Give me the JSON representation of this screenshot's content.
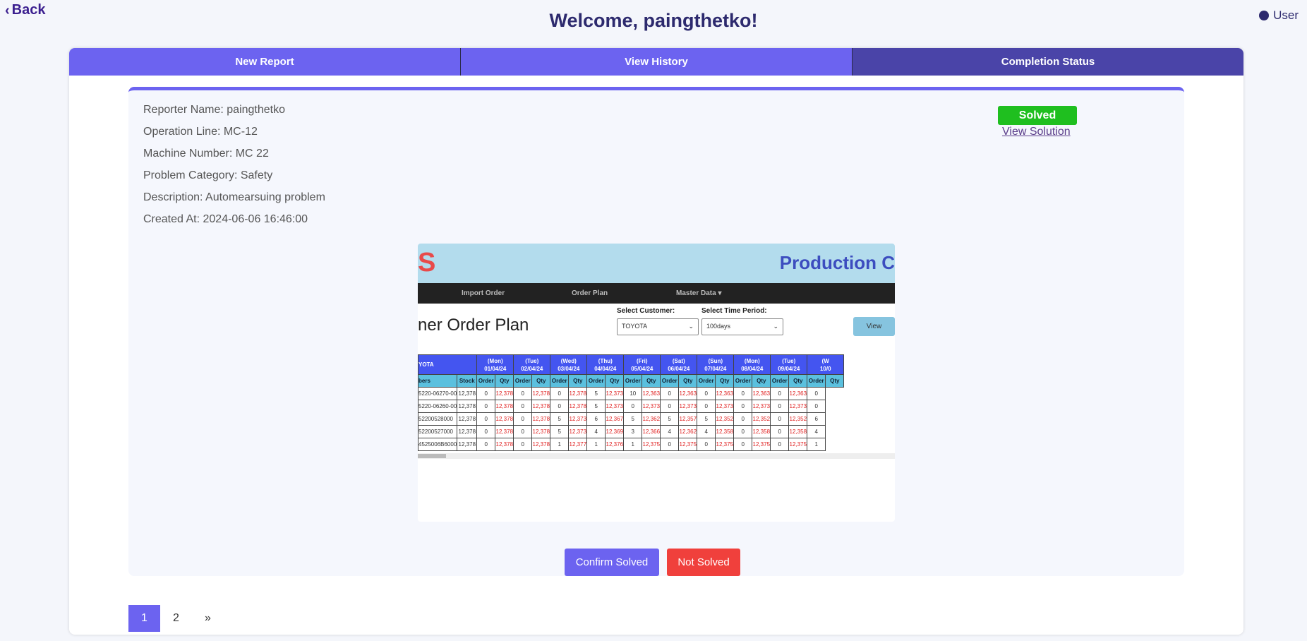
{
  "back_label": "Back",
  "user_label": "User",
  "title": "Welcome, paingthetko!",
  "tabs": [
    {
      "label": "New Report"
    },
    {
      "label": "View History"
    },
    {
      "label": "Completion Status"
    }
  ],
  "report": {
    "reporter": "Reporter Name: paingthetko",
    "line": "Operation Line: MC-12",
    "machine": "Machine Number: MC 22",
    "category": "Problem Category: Safety",
    "description": "Description: Automearsuing problem",
    "created": "Created At: 2024-06-06 16:46:00",
    "status": "Solved",
    "view_solution": "View Solution"
  },
  "shot": {
    "logo_letter": "S",
    "app_title": "Production C",
    "nav": [
      "Import Order",
      "Order Plan",
      "Master Data ▾"
    ],
    "plan_title": "ner Order Plan",
    "customer_label": "Select Customer:",
    "customer_value": "TOYOTA",
    "period_label": "Select Time Period:",
    "period_value": "100days",
    "view_btn": "View",
    "table": {
      "customer": "YOTA",
      "numbers_header": "bers",
      "stock_header": "Stock",
      "days": [
        {
          "d": "(Mon)",
          "date": "01/04/24"
        },
        {
          "d": "(Tue)",
          "date": "02/04/24"
        },
        {
          "d": "(Wed)",
          "date": "03/04/24"
        },
        {
          "d": "(Thu)",
          "date": "04/04/24"
        },
        {
          "d": "(Fri)",
          "date": "05/04/24"
        },
        {
          "d": "(Sat)",
          "date": "06/04/24"
        },
        {
          "d": "(Sun)",
          "date": "07/04/24"
        },
        {
          "d": "(Mon)",
          "date": "08/04/24"
        },
        {
          "d": "(Tue)",
          "date": "09/04/24"
        },
        {
          "d": "(W",
          "date": "10/0"
        }
      ],
      "order_label": "Order",
      "qty_label": "Qty",
      "rows": [
        {
          "part": "5220-06270-00",
          "stock": "12,378",
          "cells": [
            "0",
            "12,378",
            "0",
            "12,378",
            "0",
            "12,378",
            "5",
            "12,373",
            "10",
            "12,363",
            "0",
            "12,363",
            "0",
            "12,363",
            "0",
            "12,363",
            "0",
            "12,363",
            "0"
          ]
        },
        {
          "part": "5220-06260-00",
          "stock": "12,378",
          "cells": [
            "0",
            "12,378",
            "0",
            "12,378",
            "0",
            "12,378",
            "5",
            "12,373",
            "0",
            "12,373",
            "0",
            "12,373",
            "0",
            "12,373",
            "0",
            "12,373",
            "0",
            "12,373",
            "0"
          ]
        },
        {
          "part": "52200528000",
          "stock": "12,378",
          "cells": [
            "0",
            "12,378",
            "0",
            "12,378",
            "5",
            "12,373",
            "6",
            "12,367",
            "5",
            "12,362",
            "5",
            "12,357",
            "5",
            "12,352",
            "0",
            "12,352",
            "0",
            "12,352",
            "6"
          ]
        },
        {
          "part": "52200527000",
          "stock": "12,378",
          "cells": [
            "0",
            "12,378",
            "0",
            "12,378",
            "5",
            "12,373",
            "4",
            "12,369",
            "3",
            "12,366",
            "4",
            "12,362",
            "4",
            "12,358",
            "0",
            "12,358",
            "0",
            "12,358",
            "4"
          ]
        },
        {
          "part": "4525006B6000",
          "stock": "12,378",
          "cells": [
            "0",
            "12,378",
            "0",
            "12,378",
            "1",
            "12,377",
            "1",
            "12,376",
            "1",
            "12,375",
            "0",
            "12,375",
            "0",
            "12,375",
            "0",
            "12,375",
            "0",
            "12,375",
            "1"
          ]
        }
      ]
    }
  },
  "actions": {
    "confirm": "Confirm Solved",
    "not_solved": "Not Solved"
  },
  "pagination": {
    "pages": [
      "1",
      "2"
    ],
    "next": "»",
    "current": "1"
  },
  "colors": {
    "accent": "#6c63f0",
    "active_tab": "#4a44a8",
    "success": "#1fbf1f",
    "danger": "#f0403c",
    "title": "#2d2a6e"
  }
}
